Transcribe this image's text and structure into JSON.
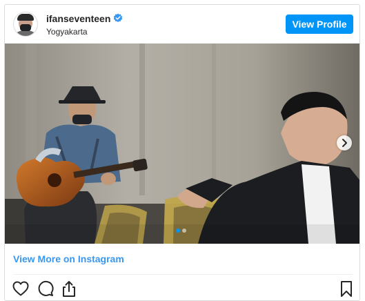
{
  "post": {
    "username": "ifanseventeen",
    "location": "Yogyakarta",
    "view_profile_label": "View Profile",
    "view_more_label": "View More on Instagram"
  },
  "carousel": {
    "current": 1,
    "total": 2
  },
  "icons": {
    "verified": "verified-badge-icon",
    "next": "chevron-right-icon",
    "like": "heart-icon",
    "comment": "comment-icon",
    "share": "share-icon",
    "save": "bookmark-icon"
  },
  "colors": {
    "accent": "#0095f6",
    "link": "#3897f0",
    "text": "#262626"
  }
}
